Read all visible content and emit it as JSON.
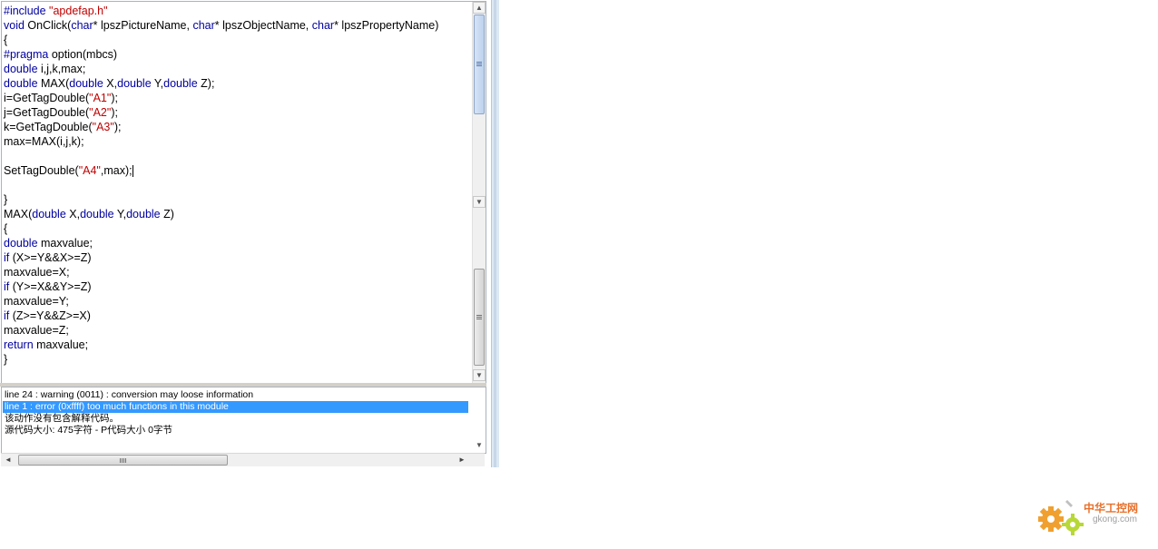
{
  "code_lines": [
    [
      {
        "t": "#include ",
        "c": "kw"
      },
      {
        "t": "\"apdefap.h\"",
        "c": "str"
      }
    ],
    [
      {
        "t": "void",
        "c": "kw"
      },
      {
        "t": " OnClick("
      },
      {
        "t": "char",
        "c": "kw"
      },
      {
        "t": "* lpszPictureName, "
      },
      {
        "t": "char",
        "c": "kw"
      },
      {
        "t": "* lpszObjectName, "
      },
      {
        "t": "char",
        "c": "kw"
      },
      {
        "t": "* lpszPropertyName)"
      }
    ],
    [
      {
        "t": "{"
      }
    ],
    [
      {
        "t": "#pragma",
        "c": "kw"
      },
      {
        "t": " option(mbcs)"
      }
    ],
    [
      {
        "t": "double",
        "c": "kw"
      },
      {
        "t": " i,j,k,max;"
      }
    ],
    [
      {
        "t": "double",
        "c": "kw"
      },
      {
        "t": " MAX("
      },
      {
        "t": "double",
        "c": "kw"
      },
      {
        "t": " X,"
      },
      {
        "t": "double",
        "c": "kw"
      },
      {
        "t": " Y,"
      },
      {
        "t": "double",
        "c": "kw"
      },
      {
        "t": " Z);"
      }
    ],
    [
      {
        "t": "i=GetTagDouble("
      },
      {
        "t": "\"A1\"",
        "c": "str"
      },
      {
        "t": ");"
      }
    ],
    [
      {
        "t": "j=GetTagDouble("
      },
      {
        "t": "\"A2\"",
        "c": "str"
      },
      {
        "t": ");"
      }
    ],
    [
      {
        "t": "k=GetTagDouble("
      },
      {
        "t": "\"A3\"",
        "c": "str"
      },
      {
        "t": ");"
      }
    ],
    [
      {
        "t": "max=MAX(i,j,k);"
      }
    ],
    [],
    [
      {
        "t": "SetTagDouble("
      },
      {
        "t": "\"A4\"",
        "c": "str"
      },
      {
        "t": ",max);"
      },
      {
        "caret": true
      }
    ],
    [],
    [
      {
        "t": "}"
      }
    ],
    [
      {
        "t": "MAX("
      },
      {
        "t": "double",
        "c": "kw"
      },
      {
        "t": " X,"
      },
      {
        "t": "double",
        "c": "kw"
      },
      {
        "t": " Y,"
      },
      {
        "t": "double",
        "c": "kw"
      },
      {
        "t": " Z)"
      }
    ],
    [
      {
        "t": "{"
      }
    ],
    [
      {
        "t": "double",
        "c": "kw"
      },
      {
        "t": " maxvalue;"
      }
    ],
    [
      {
        "t": "if",
        "c": "kw"
      },
      {
        "t": " (X>=Y&&X>=Z)"
      }
    ],
    [
      {
        "t": "maxvalue=X;"
      }
    ],
    [
      {
        "t": "if",
        "c": "kw"
      },
      {
        "t": " (Y>=X&&Y>=Z)"
      }
    ],
    [
      {
        "t": "maxvalue=Y;"
      }
    ],
    [
      {
        "t": "if",
        "c": "kw"
      },
      {
        "t": " (Z>=Y&&Z>=X)"
      }
    ],
    [
      {
        "t": "maxvalue=Z;"
      }
    ],
    [
      {
        "t": "return",
        "c": "kw"
      },
      {
        "t": " maxvalue;"
      }
    ],
    [
      {
        "t": "}"
      }
    ]
  ],
  "output": {
    "lines": [
      {
        "text": "line 24 : warning (0011) : conversion may loose information",
        "selected": false
      },
      {
        "text": "line 1 : error (0xffff) too much functions in this module",
        "selected": true
      },
      {
        "text": "该动作没有包含解释代码。",
        "selected": false
      },
      {
        "text": "源代码大小: 475字符 - P代码大小 0字节",
        "selected": false
      }
    ]
  },
  "icons": {
    "up_arrow": "▲",
    "down_arrow": "▼",
    "left_arrow": "◄",
    "right_arrow": "►"
  },
  "watermark": {
    "site_name": "中华工控网",
    "domain": "gkong.com"
  },
  "colors": {
    "keyword": "#0000a0",
    "string": "#c00000",
    "selection": "#3399ff",
    "watermark_gear": "#f0a030"
  }
}
